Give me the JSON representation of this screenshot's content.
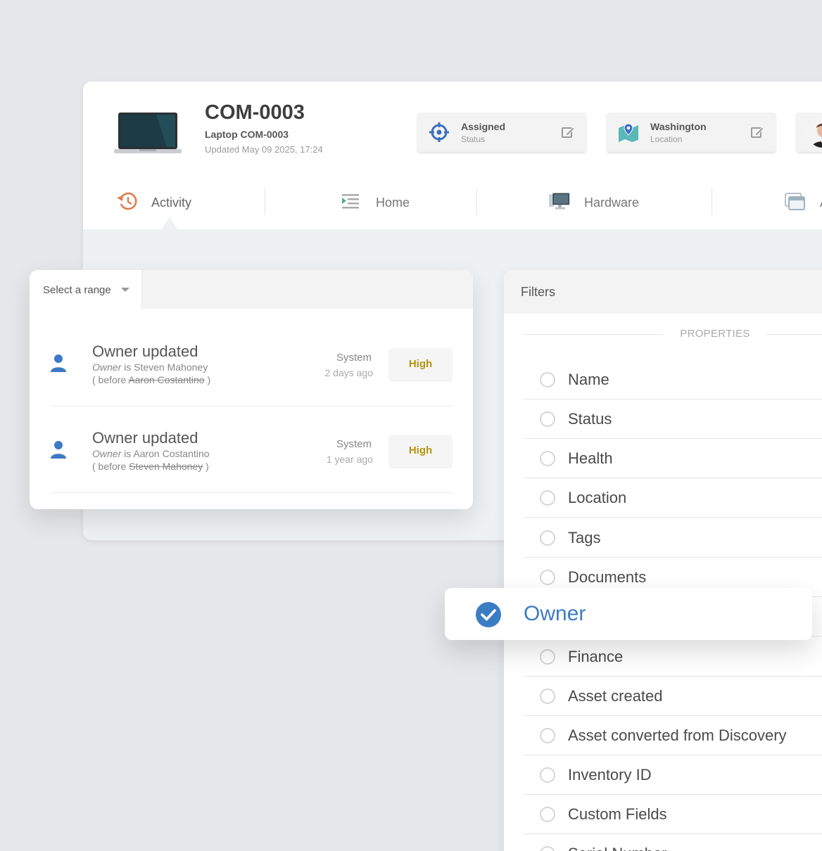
{
  "asset": {
    "code": "COM-0003",
    "name": "Laptop COM-0003",
    "updated": "Updated May 09 2025, 17:24"
  },
  "chips": {
    "status": {
      "value": "Assigned",
      "label": "Status",
      "icon": "crosshair-icon"
    },
    "location": {
      "value": "Washington",
      "label": "Location",
      "icon": "map-pin-icon"
    },
    "owner": {
      "icon": "avatar"
    }
  },
  "tabs": [
    {
      "label": "Activity",
      "icon": "history-icon"
    },
    {
      "label": "Home",
      "icon": "list-icon"
    },
    {
      "label": "Hardware",
      "icon": "monitor-icon"
    },
    {
      "label": "A",
      "icon": "window-icon"
    }
  ],
  "activity": {
    "range_label": "Select a range",
    "entries": [
      {
        "title": "Owner updated",
        "field": "Owner",
        "is_text": " is Steven Mahoney",
        "before_prefix": "( before ",
        "before_value": "Aaron Costantino",
        "before_suffix": " )",
        "source": "System",
        "time": "2 days ago",
        "priority": "High"
      },
      {
        "title": "Owner updated",
        "field": "Owner",
        "is_text": " is Aaron Costantino",
        "before_prefix": "( before ",
        "before_value": "Steven Mahoney",
        "before_suffix": " )",
        "source": "System",
        "time": "1 year ago",
        "priority": "High"
      }
    ]
  },
  "filters": {
    "title": "Filters",
    "section": "PROPERTIES",
    "items": [
      "Name",
      "Status",
      "Health",
      "Location",
      "Tags",
      "Documents",
      "Owner",
      "Finance",
      "Asset created",
      "Asset converted from Discovery",
      "Inventory ID",
      "Custom Fields",
      "Serial Number"
    ],
    "selected": "Owner"
  },
  "colors": {
    "accent": "#3b7dc5",
    "priority_high": "#b39410",
    "history_icon": "#e07b4f"
  }
}
